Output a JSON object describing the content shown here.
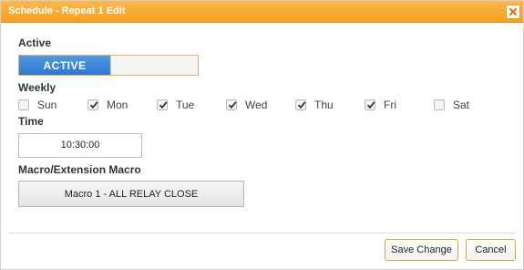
{
  "dialog": {
    "title": "Schedule - Repeat 1 Edit"
  },
  "active": {
    "label": "Active",
    "toggle_text": "ACTIVE",
    "value": true
  },
  "weekly": {
    "label": "Weekly",
    "days": [
      {
        "name": "Sun",
        "checked": false
      },
      {
        "name": "Mon",
        "checked": true
      },
      {
        "name": "Tue",
        "checked": true
      },
      {
        "name": "Wed",
        "checked": true
      },
      {
        "name": "Thu",
        "checked": true
      },
      {
        "name": "Fri",
        "checked": true
      },
      {
        "name": "Sat",
        "checked": false
      }
    ]
  },
  "time": {
    "label": "Time",
    "value": "10:30:00"
  },
  "macro": {
    "label": "Macro/Extension Macro",
    "selected": "Macro 1 - ALL RELAY CLOSE"
  },
  "footer": {
    "save_label": "Save Change",
    "cancel_label": "Cancel"
  },
  "colors": {
    "titlebar": "#f5a623",
    "toggle_active": "#3a86d8",
    "button_border": "#e0a33a"
  }
}
